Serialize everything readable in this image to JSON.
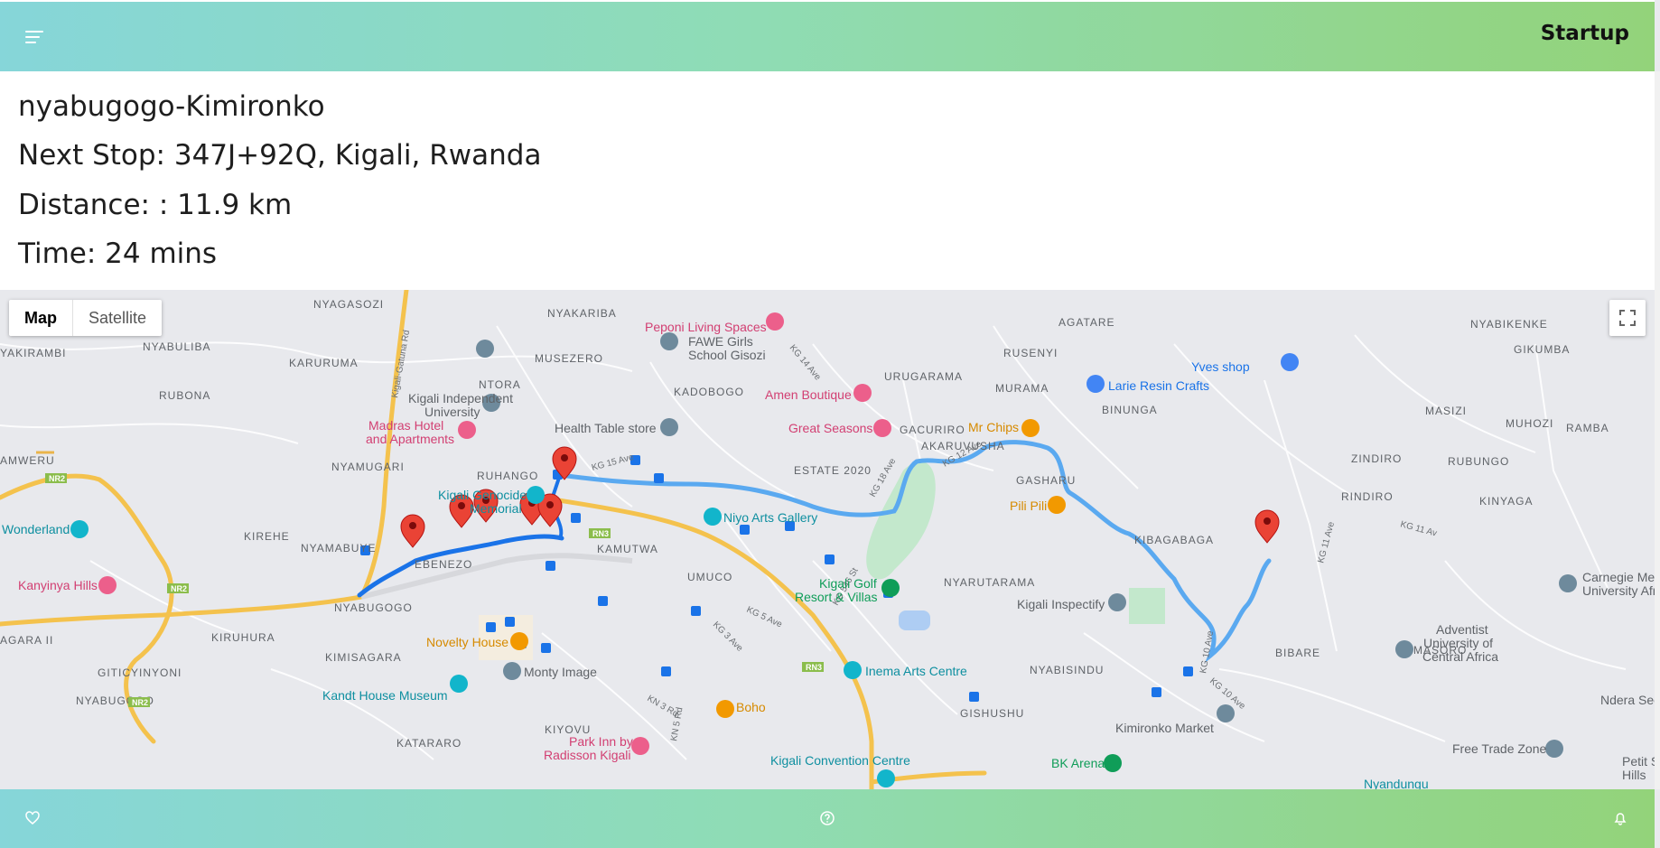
{
  "header": {
    "brand": "Startup",
    "menu_icon": "hamburger-menu-icon"
  },
  "route": {
    "name": "nyabugogo-Kimironko",
    "next_stop": "Next Stop: 347J+92Q, Kigali, Rwanda",
    "distance": "Distance: : 11.9 km",
    "time": "Time: 24 mins"
  },
  "map": {
    "type_map": "Map",
    "type_satellite": "Satellite",
    "selected_type": "Map",
    "fullscreen_icon": "fullscreen-icon",
    "route_color": "#1a73e8",
    "route_alt_color": "#5aa9f0",
    "labels": {
      "nyagasozi": "NYAGASOZI",
      "nyakariba": "NYAKARIBA",
      "agatare": "AGATARE",
      "nyabikenke": "NYABIKENKE",
      "nyabuliba": "NYABULIBA",
      "kayirambi": "YAKIRAMBI",
      "karuruma": "KARURUMA",
      "musezero": "MUSEZERO",
      "rusenyi": "RUSENYI",
      "gikumba": "GIKUMBA",
      "urugarama": "URUGARAMA",
      "murama": "MURAMA",
      "rubona": "RUBONA",
      "ntora": "NTORA",
      "kadobogo": "KADOBOGO",
      "binunga": "BINUNGA",
      "masizi": "MASIZI",
      "muhozi": "MUHOZI",
      "ramba": "RAMBA",
      "nyamugari": "NYAMUGARI",
      "gacuriro": "GACURIRO",
      "akaruvusha": "AKARUVUSHA",
      "zindiro": "ZINDIRO",
      "rubungo": "RUBUNGO",
      "amweru": "AMWERU",
      "ruhango": "RUHANGO",
      "estate2020": "ESTATE 2020",
      "gasharu": "GASHARU",
      "rindiro": "RINDIRO",
      "kinyaga": "KINYAGA",
      "kirehe": "KIREHE",
      "nyamabuye": "NYAMABUYE",
      "kamutwa": "KAMUTWA",
      "kibagabaga": "KIBAGABAGA",
      "ebenezo": "EBENEZO",
      "umuco": "UMUCO",
      "nyarutarama": "NYARUTARAMA",
      "nyabugogo": "NYABUGOGO",
      "kiruhura": "KIRUHURA",
      "agara2": "AGARA II",
      "kimisagara": "KIMISAGARA",
      "masoro": "MASORO",
      "bibare": "BIBARE",
      "nyabisindu": "NYABISINDU",
      "kimihurura": "GITICYINYONI",
      "nyabugogo2": "NYABUGOGO",
      "gishushu": "GISHUSHU",
      "kataraho": "KATARARO",
      "kiyovu": "KIYOVU"
    },
    "roads": {
      "kigali_gatuna": "Kigali-Gatuna Rd",
      "kg14": "KG 14 Ave",
      "kg15": "KG 15 Ave",
      "kg12": "KG 12 Ave",
      "kg11": "KG 11 Ave",
      "kg11av": "KG 11 Av",
      "kg10": "KG 10 Ave",
      "kg546": "KG 546 St",
      "kg3": "KG 3 Ave",
      "kg5": "KG 5 Ave",
      "kn3": "KN 3 Rd",
      "kn5": "KN 5 Rd",
      "kg18": "KG 18 Ave",
      "rn3": "RN3",
      "nr2": "NR2"
    },
    "pois": {
      "peponi": "Peponi Living Spaces",
      "fawe": "FAWE Girls\nSchool Gisozi",
      "yves": "Yves shop",
      "larie": "Larie Resin Crafts",
      "amen": "Amen Boutique",
      "kiu": "Kigali Independent\nUniversity",
      "madras": "Madras Hotel\nand Apartments",
      "health": "Health Table store",
      "great": "Great Seasons",
      "mrchips": "Mr Chips",
      "genocide": "Kigali Genocide\nMemorial",
      "niyo": "Niyo Arts Gallery",
      "pilipili": "Pili Pili",
      "wonderland": "Wonderland",
      "kanyinya": "Kanyinya Hills",
      "golf": "Kigali Golf\nResort & Villas",
      "inspectify": "Kigali Inspectify",
      "carnegie": "Carnegie Mel\nUniversity Afr",
      "novelty": "Novelty House",
      "monty": "Monty Image",
      "adventist": "Adventist\nUniversity of\nCentral Africa",
      "kandt": "Kandt House Museum",
      "inema": "Inema Arts Centre",
      "boho": "Boho",
      "kimironko": "Kimironko Market",
      "ndera": "Ndera Sec",
      "parkinn": "Park Inn by\nRadisson Kigali",
      "convention": "Kigali Convention Centre",
      "bkarena": "BK Arena",
      "freetrade": "Free Trade Zone",
      "petit": "Petit Se\nHills",
      "nyandungu": "Nyandungu"
    }
  },
  "footer": {
    "favorite_icon": "heart-icon",
    "help_icon": "help-icon",
    "notification_icon": "bell-icon"
  }
}
